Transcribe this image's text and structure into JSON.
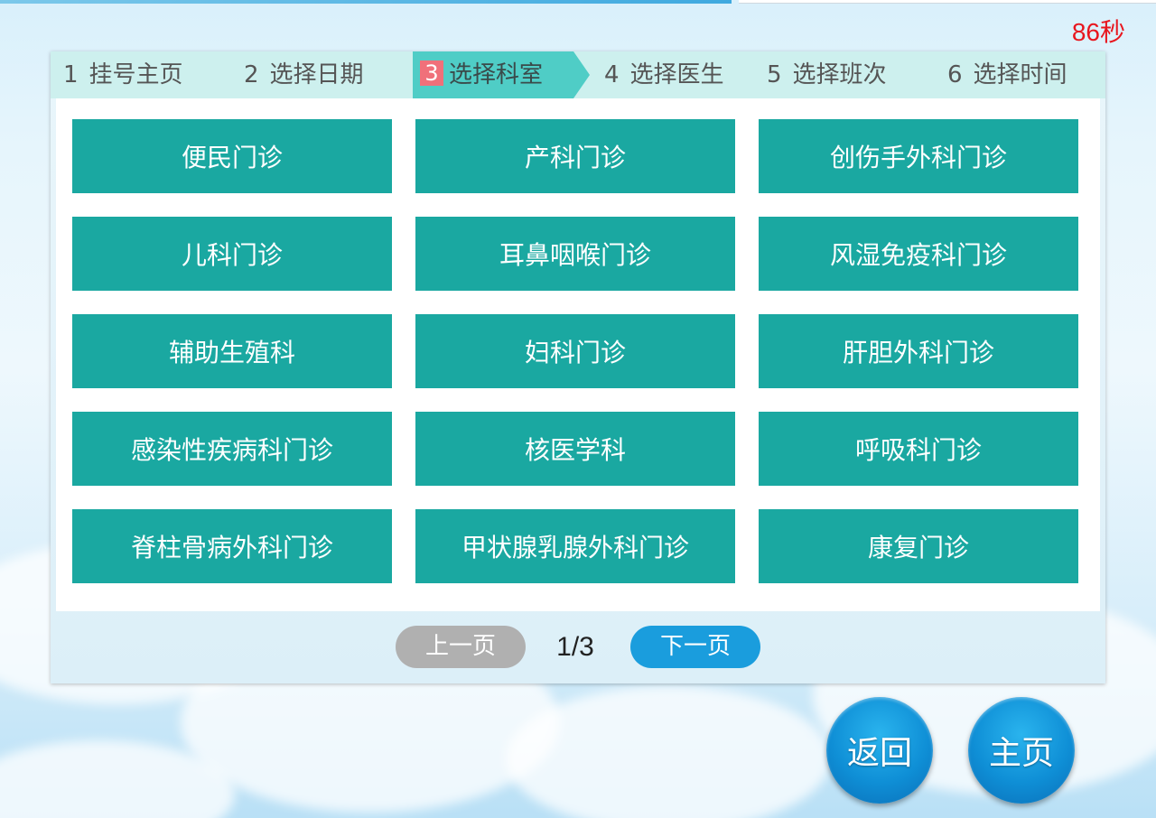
{
  "countdown": "86秒",
  "steps": [
    {
      "num": "1",
      "label": "挂号主页"
    },
    {
      "num": "2",
      "label": "选择日期"
    },
    {
      "num": "3",
      "label": "选择科室"
    },
    {
      "num": "4",
      "label": "选择医生"
    },
    {
      "num": "5",
      "label": "选择班次"
    },
    {
      "num": "6",
      "label": "选择时间"
    }
  ],
  "active_step": 3,
  "departments": [
    "便民门诊",
    "产科门诊",
    "创伤手外科门诊",
    "儿科门诊",
    "耳鼻咽喉门诊",
    "风湿免疫科门诊",
    "辅助生殖科",
    "妇科门诊",
    "肝胆外科门诊",
    "感染性疾病科门诊",
    "核医学科",
    "呼吸科门诊",
    "脊柱骨病外科门诊",
    "甲状腺乳腺外科门诊",
    "康复门诊"
  ],
  "pager": {
    "prev_label": "上一页",
    "next_label": "下一页",
    "current": "1/3"
  },
  "actions": {
    "back_label": "返回",
    "home_label": "主页"
  },
  "colors": {
    "step_bar": "#cdf0ee",
    "step_active": "#4fcdc6",
    "step_num_active": "#f0707a",
    "dept_button": "#1aa8a1",
    "next_button": "#1a9ddd",
    "prev_button": "#b0b0b0",
    "countdown": "#e8161e"
  }
}
